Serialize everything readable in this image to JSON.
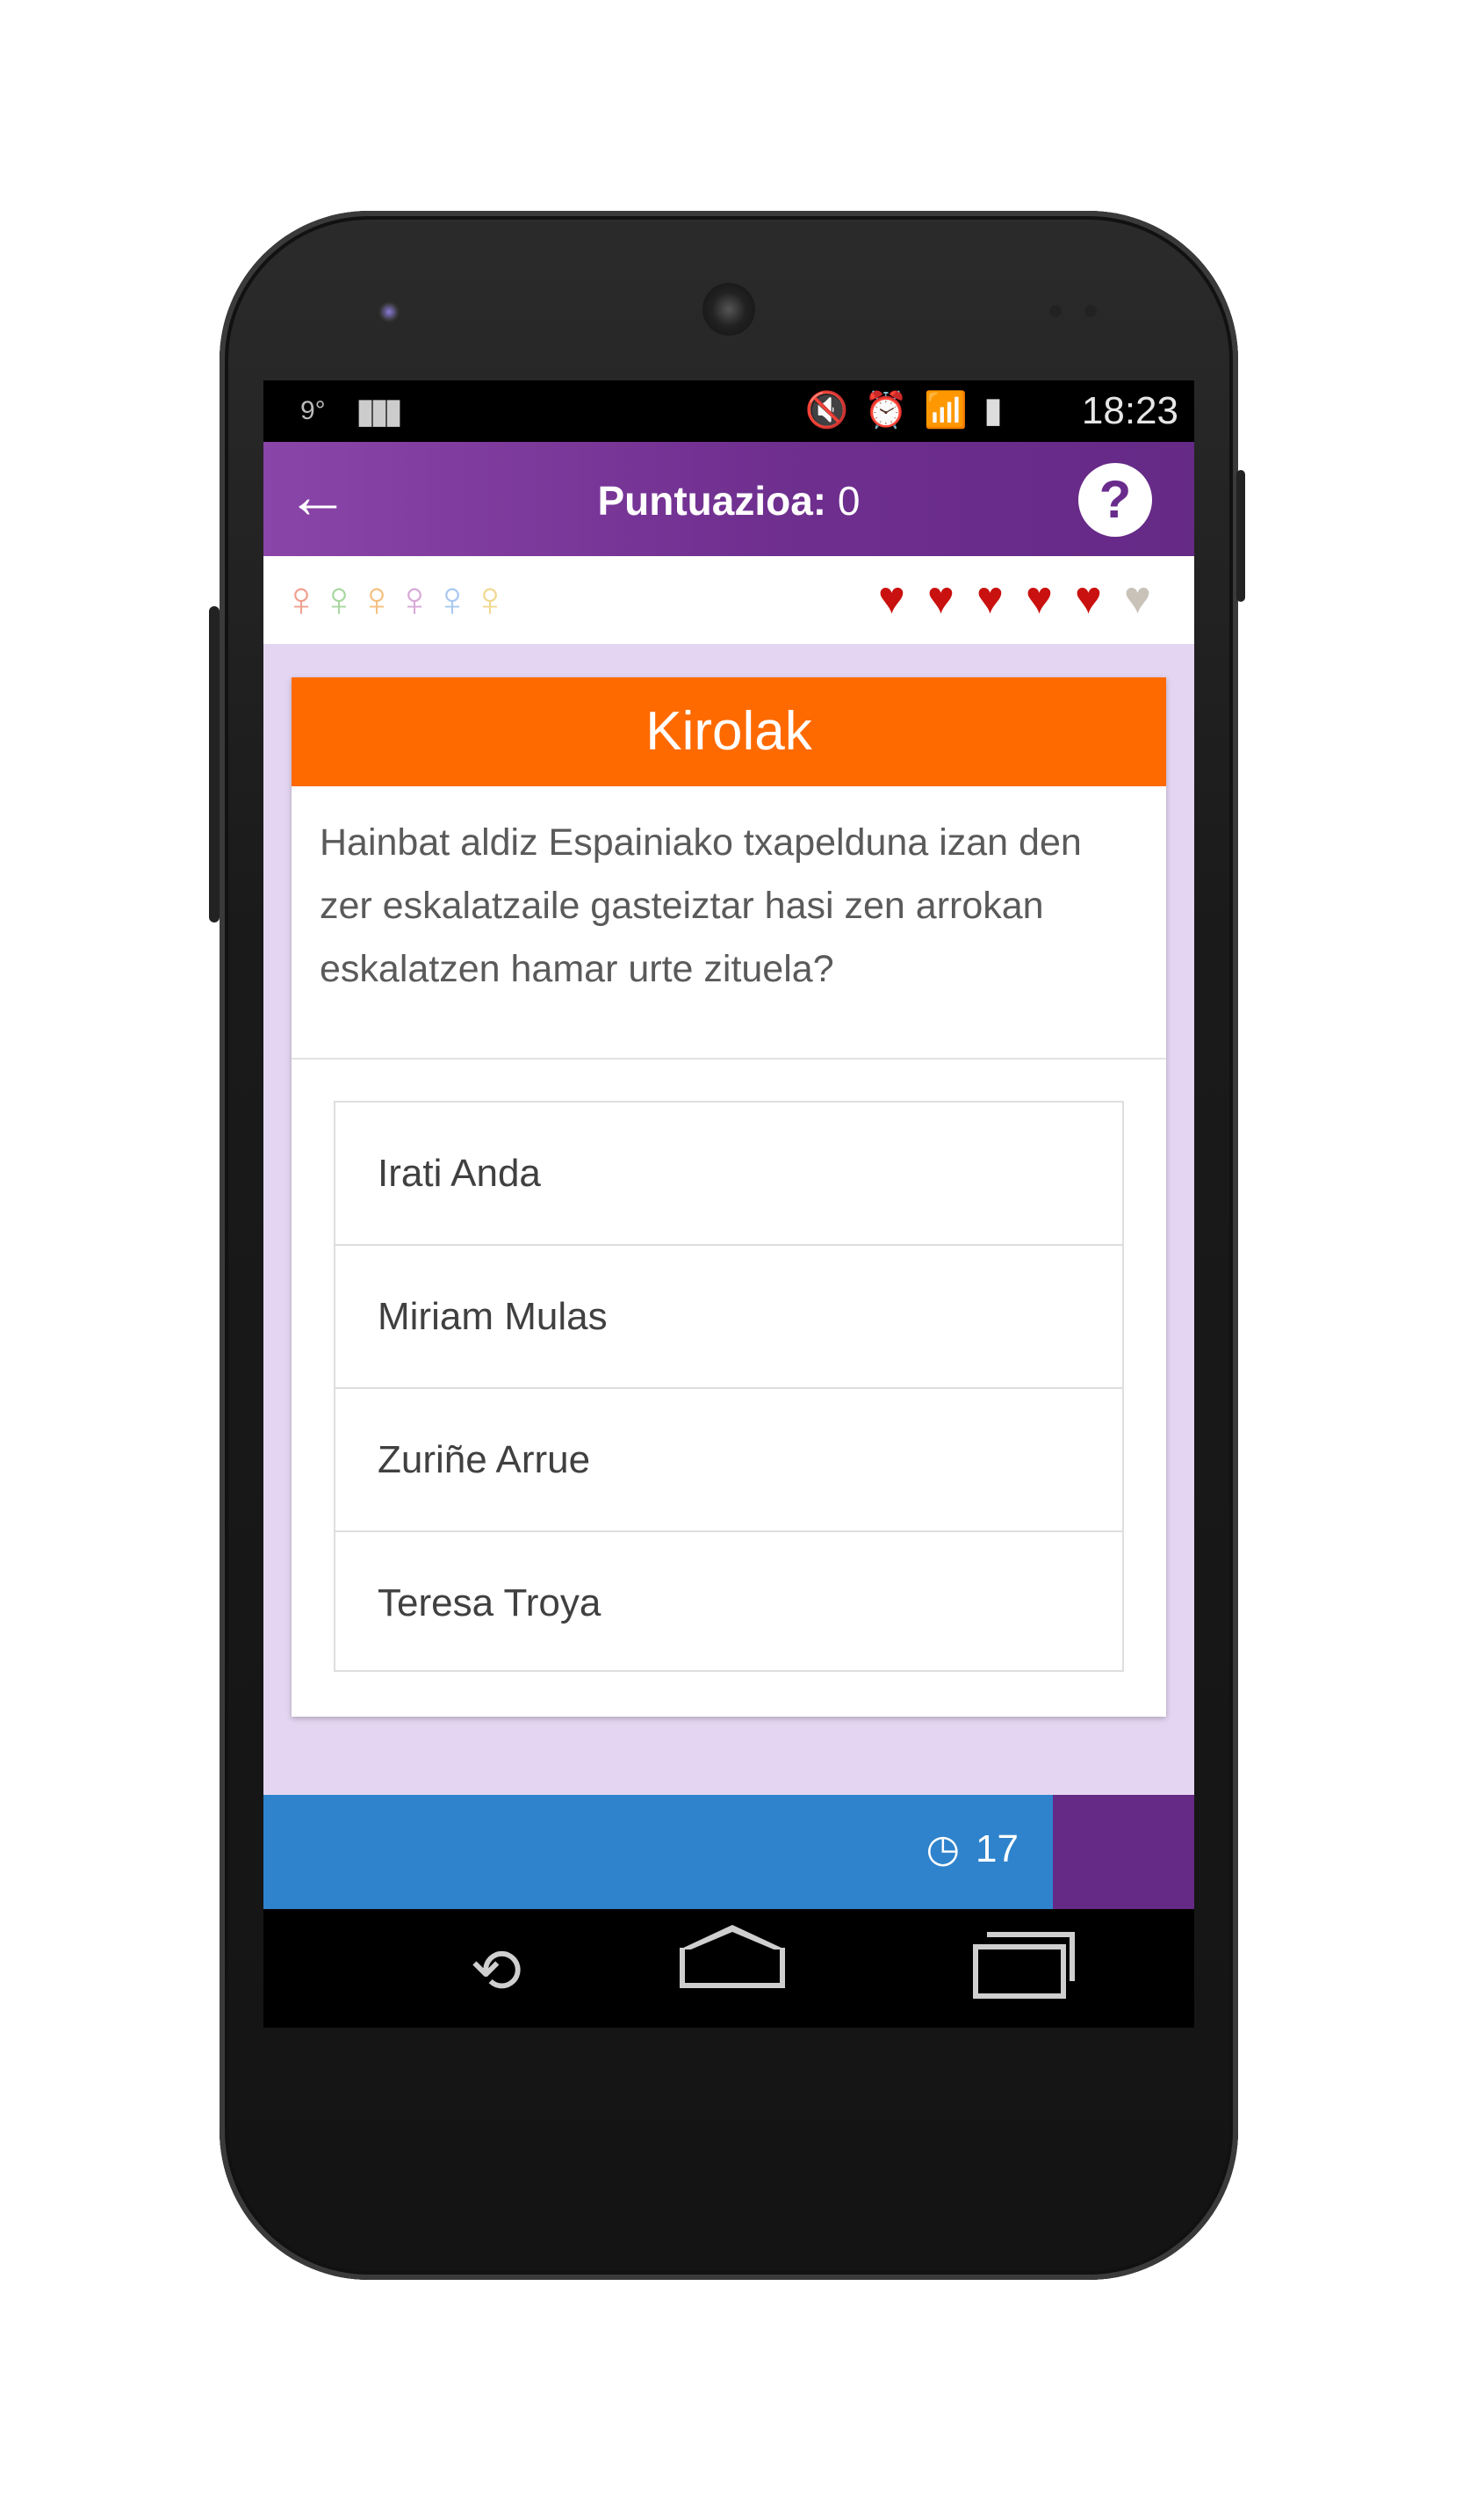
{
  "status_bar": {
    "temperature": "9°",
    "notification_icon": "barcode-icon",
    "icons": [
      "mute-icon",
      "alarm-icon",
      "wifi-icon",
      "signal-icon",
      "battery-icon"
    ],
    "time": "18:23"
  },
  "app_bar": {
    "back_icon": "back-arrow-icon",
    "score_label": "Puntuazioa:",
    "score_value": "0",
    "help_label": "?"
  },
  "status_row": {
    "venus_icons": [
      {
        "color": "#f0a090"
      },
      {
        "color": "#a8d8a0"
      },
      {
        "color": "#f4c080"
      },
      {
        "color": "#d8a8d8"
      },
      {
        "color": "#a8c8f0"
      },
      {
        "color": "#f0d890"
      }
    ],
    "hearts_full": 5,
    "hearts_broken": 1,
    "heart_color": "#c9110f",
    "broken_heart_color": "#c8c2b8"
  },
  "card": {
    "category": "Kirolak",
    "category_color": "#ff6a00",
    "question": "Hainbat aldiz Espainiako txapelduna izan den zer eskalatzaile gasteiztar hasi zen arrokan eskalatzen hamar urte zituela?",
    "answers": [
      {
        "label": "Irati Anda"
      },
      {
        "label": "Miriam Mulas"
      },
      {
        "label": "Zuriñe Arrue"
      },
      {
        "label": "Teresa Troya"
      }
    ]
  },
  "timer": {
    "icon": "clock-icon",
    "seconds": "17",
    "progress_fraction": 0.848,
    "fill_color": "#2f83cc",
    "track_color": "#652986"
  },
  "nav_bar": {
    "buttons": [
      "back-nav-icon",
      "home-nav-icon",
      "recents-nav-icon"
    ]
  }
}
